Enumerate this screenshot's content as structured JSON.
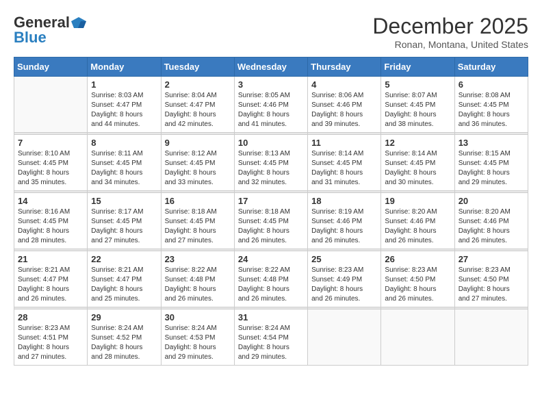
{
  "header": {
    "logo_general": "General",
    "logo_blue": "Blue",
    "month_year": "December 2025",
    "location": "Ronan, Montana, United States"
  },
  "days_of_week": [
    "Sunday",
    "Monday",
    "Tuesday",
    "Wednesday",
    "Thursday",
    "Friday",
    "Saturday"
  ],
  "weeks": [
    [
      {
        "day": "",
        "info": ""
      },
      {
        "day": "1",
        "info": "Sunrise: 8:03 AM\nSunset: 4:47 PM\nDaylight: 8 hours\nand 44 minutes."
      },
      {
        "day": "2",
        "info": "Sunrise: 8:04 AM\nSunset: 4:47 PM\nDaylight: 8 hours\nand 42 minutes."
      },
      {
        "day": "3",
        "info": "Sunrise: 8:05 AM\nSunset: 4:46 PM\nDaylight: 8 hours\nand 41 minutes."
      },
      {
        "day": "4",
        "info": "Sunrise: 8:06 AM\nSunset: 4:46 PM\nDaylight: 8 hours\nand 39 minutes."
      },
      {
        "day": "5",
        "info": "Sunrise: 8:07 AM\nSunset: 4:45 PM\nDaylight: 8 hours\nand 38 minutes."
      },
      {
        "day": "6",
        "info": "Sunrise: 8:08 AM\nSunset: 4:45 PM\nDaylight: 8 hours\nand 36 minutes."
      }
    ],
    [
      {
        "day": "7",
        "info": ""
      },
      {
        "day": "8",
        "info": "Sunrise: 8:11 AM\nSunset: 4:45 PM\nDaylight: 8 hours\nand 34 minutes."
      },
      {
        "day": "9",
        "info": "Sunrise: 8:12 AM\nSunset: 4:45 PM\nDaylight: 8 hours\nand 33 minutes."
      },
      {
        "day": "10",
        "info": "Sunrise: 8:13 AM\nSunset: 4:45 PM\nDaylight: 8 hours\nand 32 minutes."
      },
      {
        "day": "11",
        "info": "Sunrise: 8:14 AM\nSunset: 4:45 PM\nDaylight: 8 hours\nand 31 minutes."
      },
      {
        "day": "12",
        "info": "Sunrise: 8:14 AM\nSunset: 4:45 PM\nDaylight: 8 hours\nand 30 minutes."
      },
      {
        "day": "13",
        "info": "Sunrise: 8:15 AM\nSunset: 4:45 PM\nDaylight: 8 hours\nand 29 minutes."
      }
    ],
    [
      {
        "day": "14",
        "info": ""
      },
      {
        "day": "15",
        "info": "Sunrise: 8:17 AM\nSunset: 4:45 PM\nDaylight: 8 hours\nand 27 minutes."
      },
      {
        "day": "16",
        "info": "Sunrise: 8:18 AM\nSunset: 4:45 PM\nDaylight: 8 hours\nand 27 minutes."
      },
      {
        "day": "17",
        "info": "Sunrise: 8:18 AM\nSunset: 4:45 PM\nDaylight: 8 hours\nand 26 minutes."
      },
      {
        "day": "18",
        "info": "Sunrise: 8:19 AM\nSunset: 4:46 PM\nDaylight: 8 hours\nand 26 minutes."
      },
      {
        "day": "19",
        "info": "Sunrise: 8:20 AM\nSunset: 4:46 PM\nDaylight: 8 hours\nand 26 minutes."
      },
      {
        "day": "20",
        "info": "Sunrise: 8:20 AM\nSunset: 4:46 PM\nDaylight: 8 hours\nand 26 minutes."
      }
    ],
    [
      {
        "day": "21",
        "info": ""
      },
      {
        "day": "22",
        "info": "Sunrise: 8:21 AM\nSunset: 4:47 PM\nDaylight: 8 hours\nand 25 minutes."
      },
      {
        "day": "23",
        "info": "Sunrise: 8:22 AM\nSunset: 4:48 PM\nDaylight: 8 hours\nand 26 minutes."
      },
      {
        "day": "24",
        "info": "Sunrise: 8:22 AM\nSunset: 4:48 PM\nDaylight: 8 hours\nand 26 minutes."
      },
      {
        "day": "25",
        "info": "Sunrise: 8:23 AM\nSunset: 4:49 PM\nDaylight: 8 hours\nand 26 minutes."
      },
      {
        "day": "26",
        "info": "Sunrise: 8:23 AM\nSunset: 4:50 PM\nDaylight: 8 hours\nand 26 minutes."
      },
      {
        "day": "27",
        "info": "Sunrise: 8:23 AM\nSunset: 4:50 PM\nDaylight: 8 hours\nand 27 minutes."
      }
    ],
    [
      {
        "day": "28",
        "info": "Sunrise: 8:23 AM\nSunset: 4:51 PM\nDaylight: 8 hours\nand 27 minutes."
      },
      {
        "day": "29",
        "info": "Sunrise: 8:24 AM\nSunset: 4:52 PM\nDaylight: 8 hours\nand 28 minutes."
      },
      {
        "day": "30",
        "info": "Sunrise: 8:24 AM\nSunset: 4:53 PM\nDaylight: 8 hours\nand 29 minutes."
      },
      {
        "day": "31",
        "info": "Sunrise: 8:24 AM\nSunset: 4:54 PM\nDaylight: 8 hours\nand 29 minutes."
      },
      {
        "day": "",
        "info": ""
      },
      {
        "day": "",
        "info": ""
      },
      {
        "day": "",
        "info": ""
      }
    ]
  ],
  "week7_sunday": {
    "info": "Sunrise: 8:10 AM\nSunset: 4:45 PM\nDaylight: 8 hours\nand 35 minutes."
  },
  "week14_sunday": {
    "info": "Sunrise: 8:16 AM\nSunset: 4:45 PM\nDaylight: 8 hours\nand 28 minutes."
  },
  "week21_sunday": {
    "info": "Sunrise: 8:21 AM\nSunset: 4:47 PM\nDaylight: 8 hours\nand 26 minutes."
  }
}
